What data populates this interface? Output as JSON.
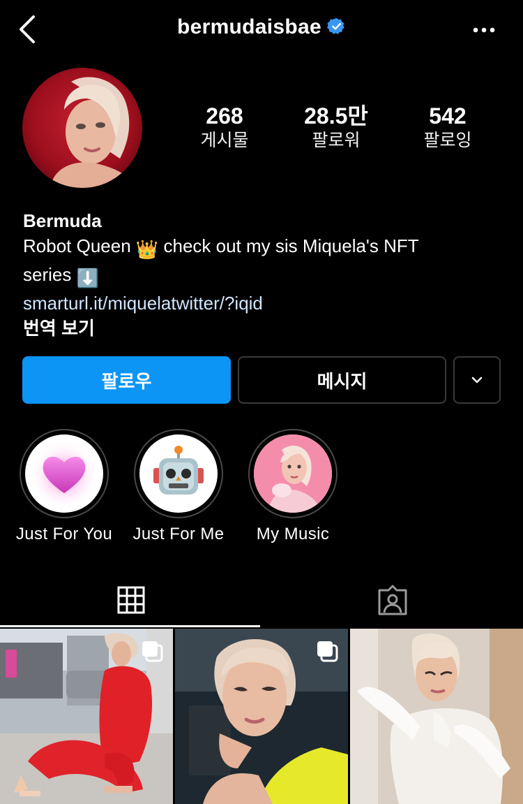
{
  "header": {
    "username": "bermudaisbae",
    "back_icon": "chevron-left-icon",
    "verified_icon": "verified-badge-icon",
    "more_icon": "more-horizontal-icon"
  },
  "stats": {
    "posts": {
      "value": "268",
      "label": "게시물"
    },
    "followers": {
      "value": "28.5만",
      "label": "팔로워"
    },
    "following": {
      "value": "542",
      "label": "팔로잉"
    }
  },
  "bio": {
    "name": "Bermuda",
    "line1_a": "Robot Queen ",
    "line1_emoji": "👑",
    "line1_b": " check out my sis Miquela's NFT",
    "line2": "series ",
    "line2_emoji": "⬇️",
    "link": "smarturl.it/miquelatwitter/?iqid",
    "translate": "번역 보기"
  },
  "actions": {
    "follow": "팔로우",
    "message": "메시지",
    "more_icon": "chevron-down-icon"
  },
  "highlights": [
    {
      "label": "Just For You",
      "icon": "pink-heart-icon"
    },
    {
      "label": "Just For Me",
      "icon": "robot-face-icon"
    },
    {
      "label": "My Music",
      "icon": "profile-photo"
    }
  ],
  "tabs": {
    "grid_icon": "grid-icon",
    "tagged_icon": "tagged-person-icon"
  },
  "colors": {
    "accent": "#0d95f6",
    "verified": "#3897f0",
    "background": "#000000"
  }
}
